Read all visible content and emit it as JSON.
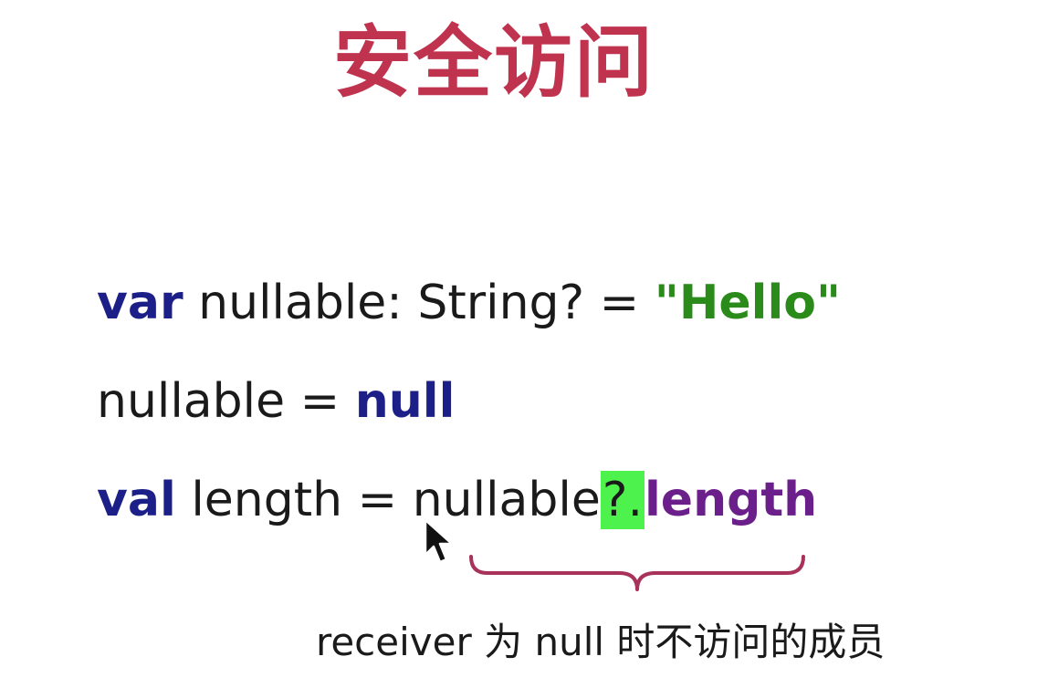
{
  "slide": {
    "title": "安全访问",
    "code": {
      "line1": {
        "keyword": "var",
        "text": " nullable: String? = ",
        "string": "\"Hello\""
      },
      "line2": {
        "text": "nullable = ",
        "keyword": "null"
      },
      "line3": {
        "keyword": "val",
        "text": " length = nullable",
        "safe_op": "?.",
        "member": "length"
      }
    },
    "caption": "receiver 为 null 时不访问的成员"
  },
  "colors": {
    "title": "#c0334f",
    "keyword": "#1b1f87",
    "string": "#2a8a1a",
    "member": "#6a1f8a",
    "safe_op_highlight": "#4df24d",
    "brace": "#a8325a"
  },
  "icons": {
    "cursor": "mouse-pointer-icon",
    "brace": "curly-brace-under-icon"
  }
}
